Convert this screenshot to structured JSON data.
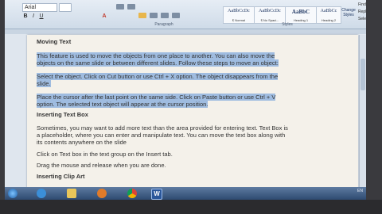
{
  "ribbon": {
    "font_name": "Arial",
    "paragraph_group": "Paragraph",
    "styles_group": "Styles",
    "styles": [
      {
        "sample": "AaBbCcDc",
        "name": "¶ Normal"
      },
      {
        "sample": "AaBbCcDc",
        "name": "¶ No Spaci..."
      },
      {
        "sample": "AaBbC",
        "name": "Heading 1"
      },
      {
        "sample": "AaBbCc",
        "name": "Heading 2"
      }
    ],
    "change_styles": "Change Styles",
    "editing": [
      "Find",
      "Replace",
      "Select"
    ]
  },
  "document": {
    "heading1": "Moving Text",
    "p1_line1": "This feature is used to move the objects from one place to another. You can also move the",
    "p1_line2": "objects on the same slide or between different slides. Follow these steps to move an object:",
    "p2_line1": "Select the object. Click on Cut button or use Ctrl + X option. The object disappears from the",
    "p2_line2": "slide.",
    "p3_line1": "Place the cursor after the last point on the same side. Click on Paste button or use Ctrl + V",
    "p3_line2": "option. The selected text object will appear at the cursor position.",
    "heading2": "Inserting Text Box",
    "p4_line1": "Sometimes, you may want to add more text than the area provided for entering text. Text Box is",
    "p4_line2": "a placeholder, where you can enter and manipulate text. You can move the text box along with",
    "p4_line3": "its contents anywhere on the slide",
    "p5": "Click on Text box in the text group on the Insert tab.",
    "p6": "Drag the mouse and release when you are done.",
    "heading3": "Inserting Clip Art"
  },
  "taskbar": {
    "apps": [
      "start",
      "ie",
      "explorer",
      "media-player",
      "chrome",
      "word"
    ],
    "tray_text": "EN"
  }
}
